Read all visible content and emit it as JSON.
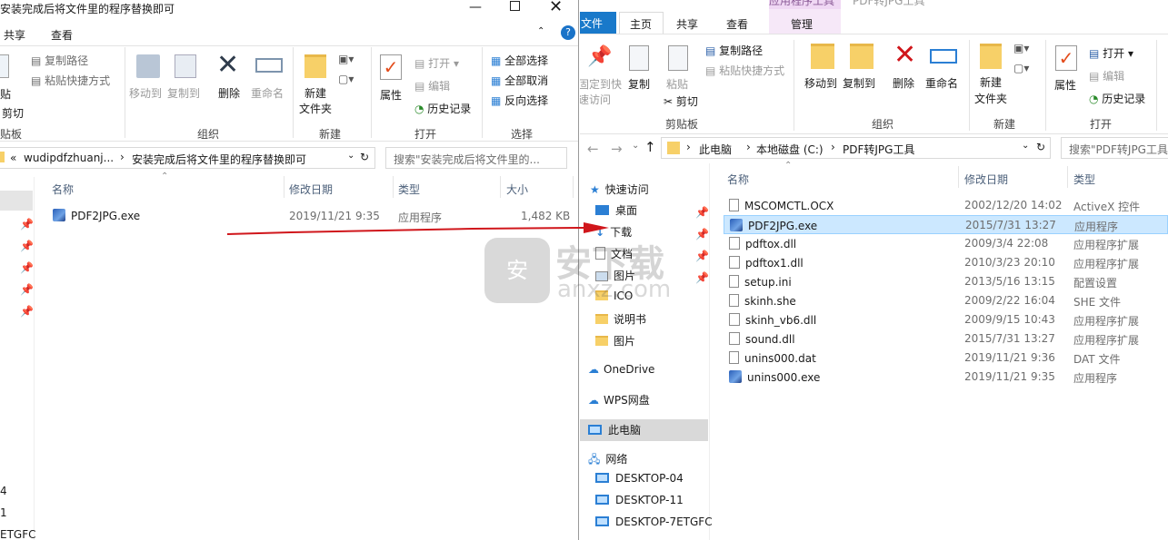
{
  "left_window": {
    "title": "安装完成后将文件里的程序替换即可",
    "tabs": [
      "共享",
      "查看"
    ],
    "ribbon": {
      "copy_path": "复制路径",
      "paste_shortcut": "粘贴快捷方式",
      "paste_partial": "贴",
      "cut": "剪切",
      "clipboard_group": "贴板",
      "move_to": "移动到",
      "copy_to": "复制到",
      "delete": "删除",
      "rename": "重命名",
      "organize_group": "组织",
      "new_folder_1": "新建",
      "new_folder_2": "文件夹",
      "new_group": "新建",
      "properties": "属性",
      "open": "打开",
      "edit": "编辑",
      "history": "历史记录",
      "open_group": "打开",
      "select_all": "全部选择",
      "select_none": "全部取消",
      "invert_select": "反向选择",
      "select_group": "选择"
    },
    "address": {
      "chevron": "«",
      "crumb1": "wudipdfzhuanj...",
      "crumb2": "安装完成后将文件里的程序替换即可"
    },
    "search_placeholder": "搜索\"安装完成后将文件里的...",
    "columns": {
      "name": "名称",
      "date": "修改日期",
      "type": "类型",
      "size": "大小"
    },
    "files": [
      {
        "name": "PDF2JPG.exe",
        "date": "2019/11/21 9:35",
        "type": "应用程序",
        "size": "1,482 KB"
      }
    ],
    "side_fragments": [
      "4",
      "1",
      "ETGFC"
    ]
  },
  "right_window": {
    "title": "PDF转JPG工具",
    "context_tab": "应用程序工具",
    "tabs": {
      "file": "文件",
      "home": "主页",
      "share": "共享",
      "view": "查看",
      "manage": "管理"
    },
    "ribbon": {
      "pin_1": "固定到快",
      "pin_2": "速访问",
      "copy": "复制",
      "paste": "粘贴",
      "copy_path": "复制路径",
      "paste_shortcut": "粘贴快捷方式",
      "cut": "剪切",
      "clipboard_group": "剪贴板",
      "move_to": "移动到",
      "copy_to": "复制到",
      "delete": "删除",
      "rename": "重命名",
      "organize_group": "组织",
      "new_folder_1": "新建",
      "new_folder_2": "文件夹",
      "new_group": "新建",
      "properties": "属性",
      "open": "打开",
      "edit": "编辑",
      "history": "历史记录",
      "open_group": "打开"
    },
    "address": {
      "crumb1": "此电脑",
      "crumb2": "本地磁盘 (C:)",
      "crumb3": "PDF转JPG工具"
    },
    "search_placeholder": "搜索\"PDF转JPG工具",
    "nav": {
      "quick_access": "快速访问",
      "desktop": "桌面",
      "downloads": "下载",
      "documents": "文档",
      "pictures": "图片",
      "ico": "ICO",
      "manual": "说明书",
      "pictures2": "图片",
      "onedrive": "OneDrive",
      "wps": "WPS网盘",
      "this_pc": "此电脑",
      "network": "网络",
      "desktop04": "DESKTOP-04",
      "desktop11": "DESKTOP-11",
      "desktop7": "DESKTOP-7ETGFC"
    },
    "columns": {
      "name": "名称",
      "date": "修改日期",
      "type": "类型"
    },
    "files": [
      {
        "name": "MSCOMCTL.OCX",
        "date": "2002/12/20 14:02",
        "type": "ActiveX 控件"
      },
      {
        "name": "PDF2JPG.exe",
        "date": "2015/7/31 13:27",
        "type": "应用程序"
      },
      {
        "name": "pdftox.dll",
        "date": "2009/3/4 22:08",
        "type": "应用程序扩展"
      },
      {
        "name": "pdftox1.dll",
        "date": "2010/3/23 20:10",
        "type": "应用程序扩展"
      },
      {
        "name": "setup.ini",
        "date": "2013/5/16 13:15",
        "type": "配置设置"
      },
      {
        "name": "skinh.she",
        "date": "2009/2/22 16:04",
        "type": "SHE 文件"
      },
      {
        "name": "skinh_vb6.dll",
        "date": "2009/9/15 10:43",
        "type": "应用程序扩展"
      },
      {
        "name": "sound.dll",
        "date": "2015/7/31 13:27",
        "type": "应用程序扩展"
      },
      {
        "name": "unins000.dat",
        "date": "2019/11/21 9:36",
        "type": "DAT 文件"
      },
      {
        "name": "unins000.exe",
        "date": "2019/11/21 9:35",
        "type": "应用程序"
      }
    ]
  },
  "watermark": {
    "text": "安下载",
    "sub": "anxz.com",
    "badge": "安"
  },
  "colors": {
    "selection": "#cce8ff",
    "accent_tab": "#1979ca",
    "arrow": "#d0161b",
    "context_tab": "#f0d8f4"
  }
}
